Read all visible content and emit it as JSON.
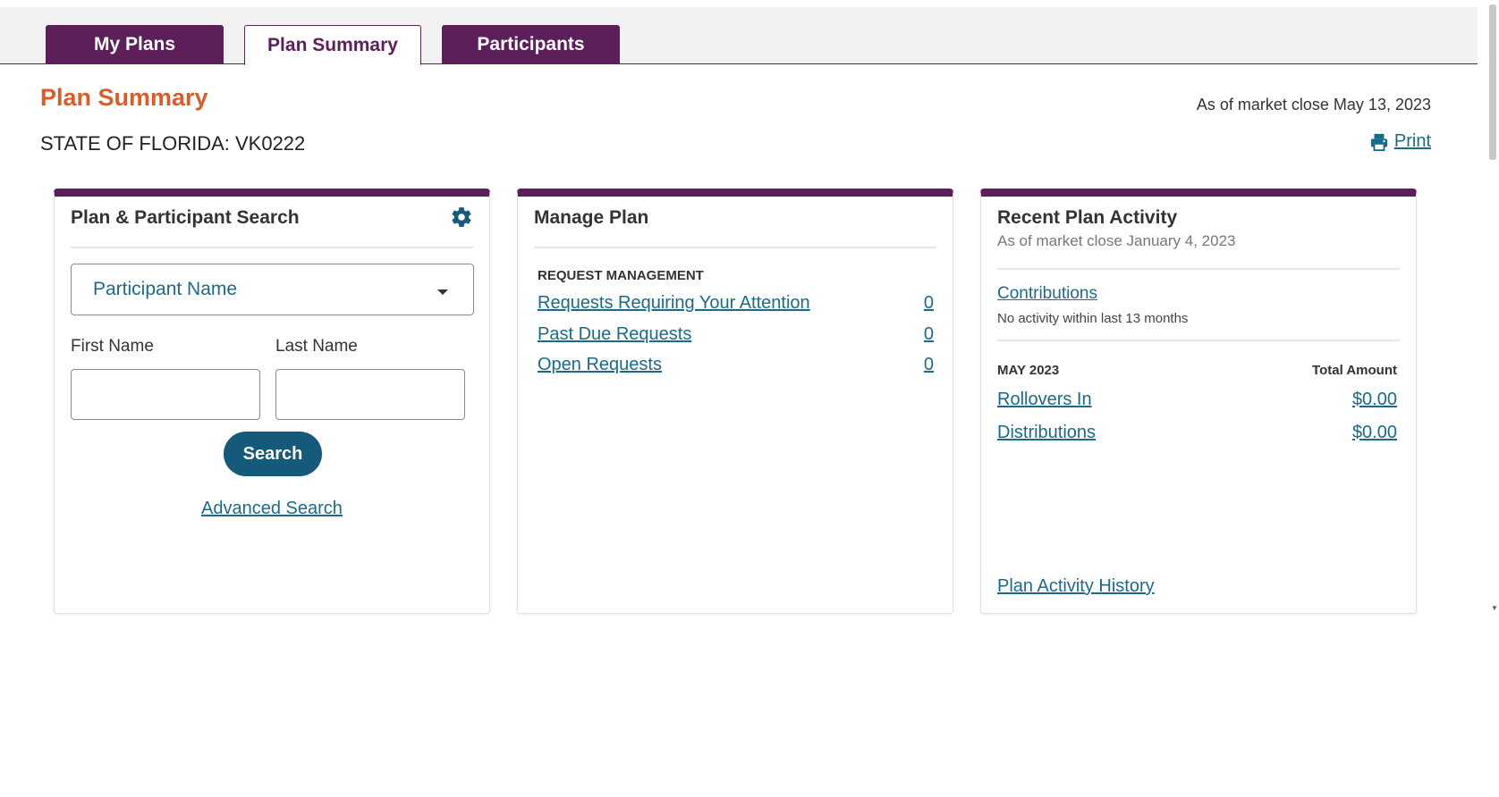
{
  "tabs": [
    {
      "label": "My Plans"
    },
    {
      "label": "Plan Summary"
    },
    {
      "label": "Participants"
    }
  ],
  "page": {
    "title": "Plan Summary",
    "plan_id": "STATE OF FLORIDA: VK0222",
    "as_of": "As of market close May 13, 2023",
    "print_label": "Print"
  },
  "search_card": {
    "title": "Plan & Participant Search",
    "search_type": "Participant Name",
    "first_name_label": "First Name",
    "last_name_label": "Last Name",
    "first_name_value": "",
    "last_name_value": "",
    "search_button": "Search",
    "advanced_link": "Advanced Search"
  },
  "manage_card": {
    "title": "Manage Plan",
    "section": "REQUEST MANAGEMENT",
    "requests": [
      {
        "label": "Requests Requiring Your Attention",
        "count": "0"
      },
      {
        "label": "Past Due Requests",
        "count": "0"
      },
      {
        "label": "Open Requests",
        "count": "0"
      }
    ]
  },
  "activity_card": {
    "title": "Recent Plan Activity",
    "subtitle": "As of market close January 4, 2023",
    "contributions_link": "Contributions",
    "no_activity": "No activity within last 13 months",
    "month": "MAY 2023",
    "total_header": "Total Amount",
    "rows": [
      {
        "label": "Rollovers In",
        "amount": "$0.00"
      },
      {
        "label": "Distributions",
        "amount": "$0.00"
      }
    ],
    "history_link": "Plan Activity History"
  },
  "colors": {
    "brand_purple": "#5c1f5a",
    "accent_orange": "#d95c2a",
    "link_blue": "#1a6a8c",
    "button_blue": "#155a7a"
  },
  "icons": {
    "gear": "gear-icon",
    "print": "print-icon",
    "dropdown": "chevron-down-icon"
  }
}
